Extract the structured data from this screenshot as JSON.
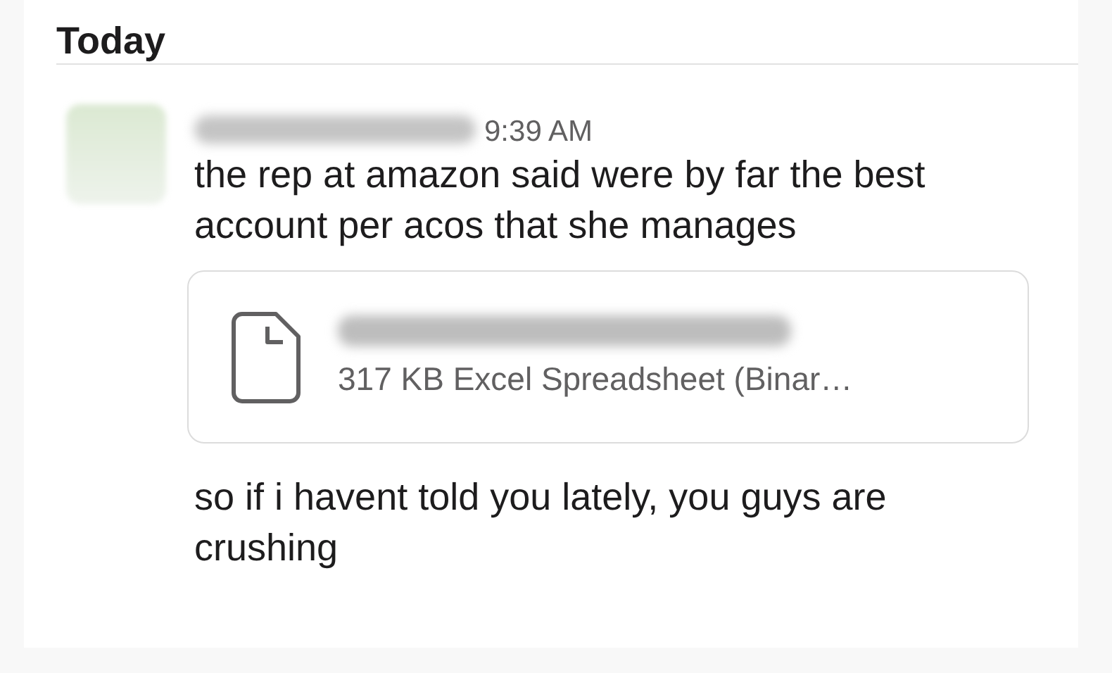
{
  "day_divider": {
    "label": "Today"
  },
  "message": {
    "timestamp": "9:39 AM",
    "paragraphs": [
      "the rep at amazon said were by far the best account per acos that she manages",
      "so if i havent told you lately, you guys are crushing"
    ],
    "attachment": {
      "details": "317 KB Excel Spreadsheet (Binar…"
    }
  }
}
